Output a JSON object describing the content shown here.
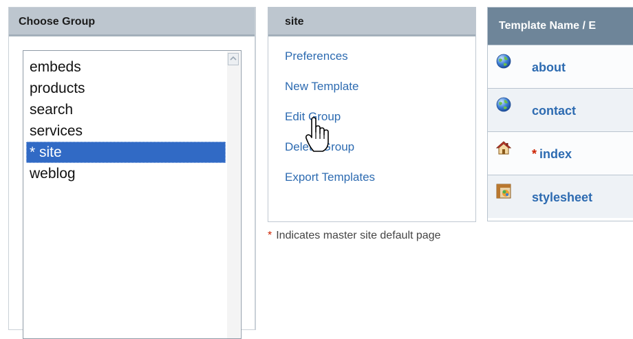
{
  "group_panel": {
    "title": "Choose Group",
    "groups": [
      "embeds",
      "products",
      "search",
      "services",
      "* site",
      "weblog"
    ],
    "selected_index": 4
  },
  "site_panel": {
    "title": "site",
    "links": [
      "Preferences",
      "New Template",
      "Edit Group",
      "Delete Group",
      "Export Templates"
    ]
  },
  "footnote": {
    "marker": "*",
    "text": "Indicates master site default page"
  },
  "templates_panel": {
    "header": "Template Name / E",
    "rows": [
      {
        "icon": "globe-icon",
        "name": "about",
        "master": false
      },
      {
        "icon": "globe-icon",
        "name": "contact",
        "master": false
      },
      {
        "icon": "home-icon",
        "name": "index",
        "master": true,
        "master_marker": "*"
      },
      {
        "icon": "stylesheet-icon",
        "name": "stylesheet",
        "master": false
      }
    ]
  },
  "colors": {
    "link": "#2d6bb1",
    "selection": "#316ac5",
    "panel_header": "#bdc6cf",
    "table_header": "#6e8599",
    "master_marker": "#cc2200"
  }
}
